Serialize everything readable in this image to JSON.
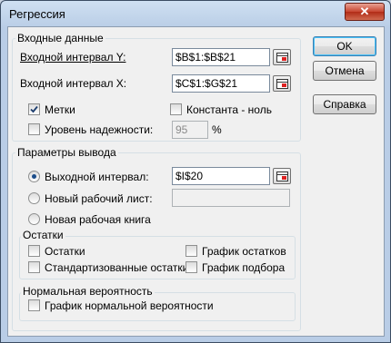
{
  "window": {
    "title": "Регрессия",
    "close_glyph": "✕"
  },
  "input_group": {
    "label": "Входные данные",
    "y_label": "Входной интервал Y:",
    "y_value": "$B$1:$B$21",
    "x_label": "Входной интервал X:",
    "x_value": "$C$1:$G$21",
    "labels_checkbox": "Метки",
    "constant_checkbox": "Константа - ноль",
    "confidence_checkbox": "Уровень надежности:",
    "confidence_value": "95",
    "confidence_unit": "%"
  },
  "output_group": {
    "label": "Параметры вывода",
    "output_range_label": "Выходной интервал:",
    "output_range_value": "$I$20",
    "new_sheet_label": "Новый рабочий лист:",
    "new_sheet_value": "",
    "new_book_label": "Новая рабочая книга"
  },
  "residuals_group": {
    "label": "Остатки",
    "residuals": "Остатки",
    "standardized": "Стандартизованные остатки",
    "residual_plots": "График остатков",
    "line_fit_plots": "График подбора"
  },
  "normal_group": {
    "label": "Нормальная вероятность",
    "normal_plot": "График нормальной вероятности"
  },
  "buttons": {
    "ok": "OK",
    "cancel": "Отмена",
    "help": "Справка"
  },
  "state": {
    "labels_checked": true,
    "constant_checked": false,
    "confidence_checked": false,
    "output_choice": "Выходной интервал:"
  },
  "colors": {
    "selected_radio_dot": "#1c4d8a",
    "default_button_border": "#3c7fb1"
  },
  "icons": [
    "close-icon",
    "range-select-icon",
    "checkmark-icon"
  ]
}
